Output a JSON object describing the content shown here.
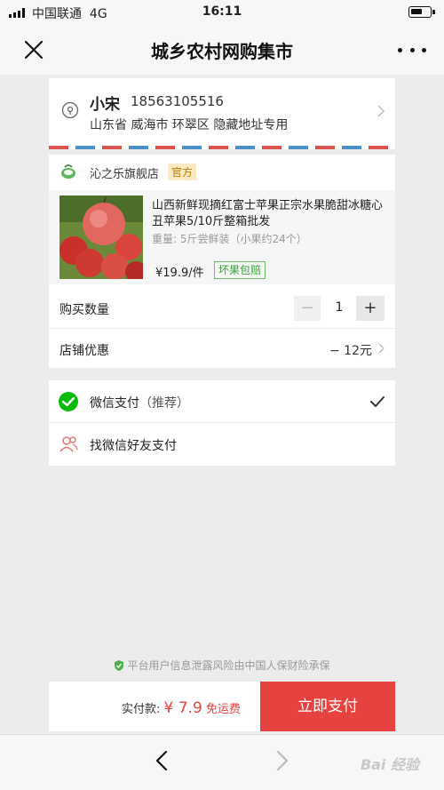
{
  "status_bar": {
    "carrier": "中国联通",
    "network": "4G",
    "time": "16:11"
  },
  "title_bar": {
    "title": "城乡农村网购集市",
    "close_icon": "close-icon",
    "more_icon": "more-icon"
  },
  "address": {
    "name": "小宋",
    "phone": "18563105516",
    "detail": "山东省 威海市 环翠区 隐藏地址专用"
  },
  "shop": {
    "name": "沁之乐旗舰店",
    "badge": "官方",
    "product": {
      "title": "山西新鲜现摘红富士苹果正宗水果脆甜冰糖心丑苹果5/10斤整箱批发",
      "weight": "重量: 5斤尝鲜装（小果约24个）",
      "price": "¥19.9/件",
      "tag": "坏果包赔"
    },
    "quantity": {
      "label": "购买数量",
      "minus": "−",
      "value": "1",
      "plus": "+"
    },
    "discount": {
      "label": "店铺优惠",
      "value": "− 12元"
    }
  },
  "payment": {
    "wechat": {
      "label": "微信支付",
      "sub": "（推荐）",
      "selected": true
    },
    "friend": {
      "label": "找微信好友支付"
    }
  },
  "insurance": {
    "text": "平台用户信息泄露风险由中国人保财险承保"
  },
  "pay_bar": {
    "total_label": "实付款: ",
    "amount": "¥ 7.9",
    "free_shipping": " 免运费",
    "button": "立即支付"
  },
  "nav": {
    "watermark": "Bai 经验"
  },
  "colors": {
    "accent": "#e64340",
    "wechat_green": "#09bb07",
    "background": "#ececec"
  }
}
